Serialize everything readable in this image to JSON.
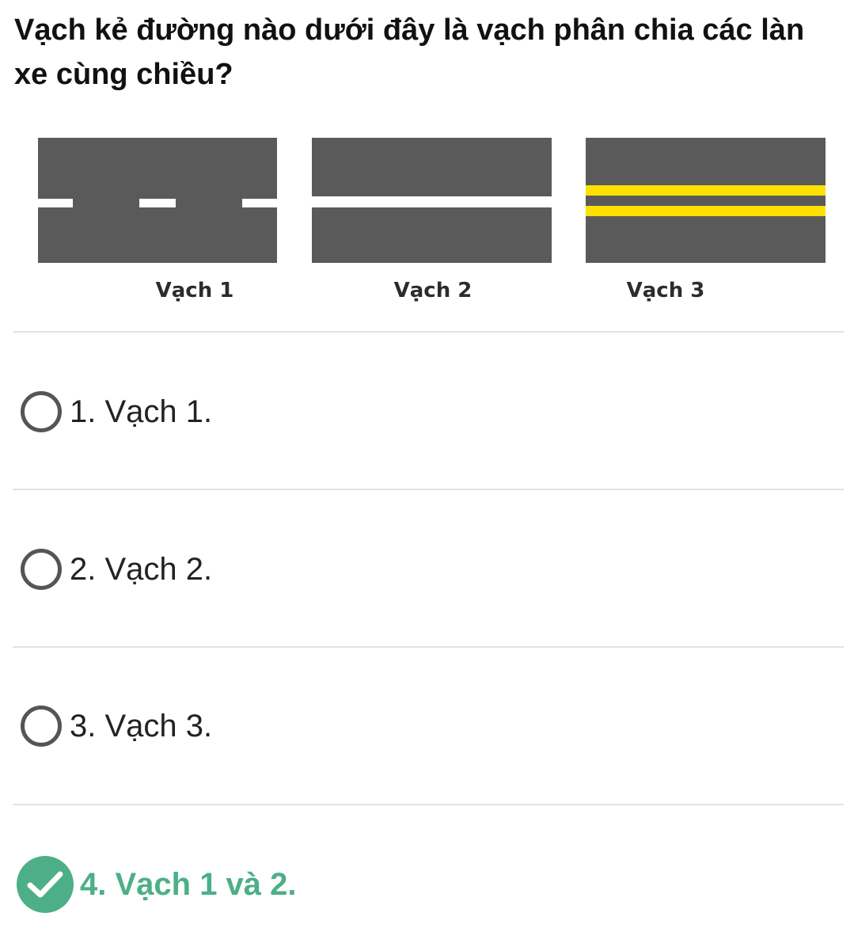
{
  "question": {
    "title": "Vạch kẻ đường nào dưới đây là vạch phân chia các làn xe cùng chiều?"
  },
  "illustration": {
    "captions": [
      "Vạch 1",
      "Vạch 2",
      "Vạch 3"
    ],
    "colors": {
      "road": "#5a5a5a",
      "white_line": "#ffffff",
      "yellow_line": "#ffe000"
    }
  },
  "options": [
    {
      "label": "1. Vạch 1.",
      "selected": false
    },
    {
      "label": "2. Vạch 2.",
      "selected": false
    },
    {
      "label": "3. Vạch 3.",
      "selected": false
    },
    {
      "label": "4. Vạch 1 và 2.",
      "selected": true
    }
  ],
  "colors": {
    "correct": "#4caf87",
    "radio_border": "#555555",
    "separator": "#e2e2e2"
  }
}
